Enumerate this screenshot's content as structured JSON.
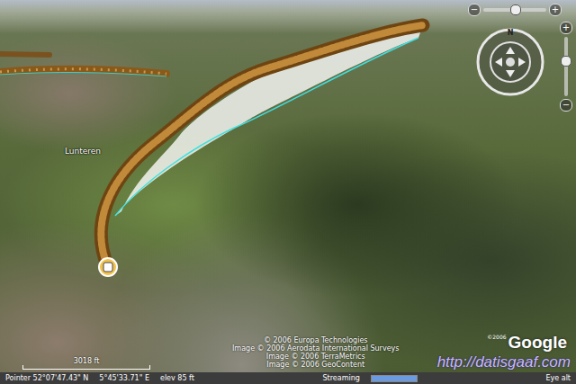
{
  "map": {
    "place_labels": [
      "Lunteren"
    ],
    "scale_bar": "3018 ft",
    "copyright": [
      "© 2006 Europa Technologies",
      "Image © 2006 Aerodata International Surveys",
      "Image © 2006 TerraMetrics",
      "Image © 2006 GeoContent"
    ],
    "logo": {
      "year": "©2006",
      "name": "Google"
    },
    "watermark": "http://datisgaaf.com"
  },
  "navigation": {
    "compass_label": "N",
    "tilt": {
      "minus": "−",
      "plus": "+",
      "level": 0.5
    },
    "zoom": {
      "plus": "+",
      "minus": "−",
      "level": 0.4
    }
  },
  "status_bar": {
    "pointer": [
      "Pointer  52°07'47.43\" N",
      "5°45'33.71\" E",
      "elev  85 ft"
    ],
    "streaming": "Streaming",
    "streaming_level": 1.0,
    "eye_alt": "Eye alt"
  }
}
